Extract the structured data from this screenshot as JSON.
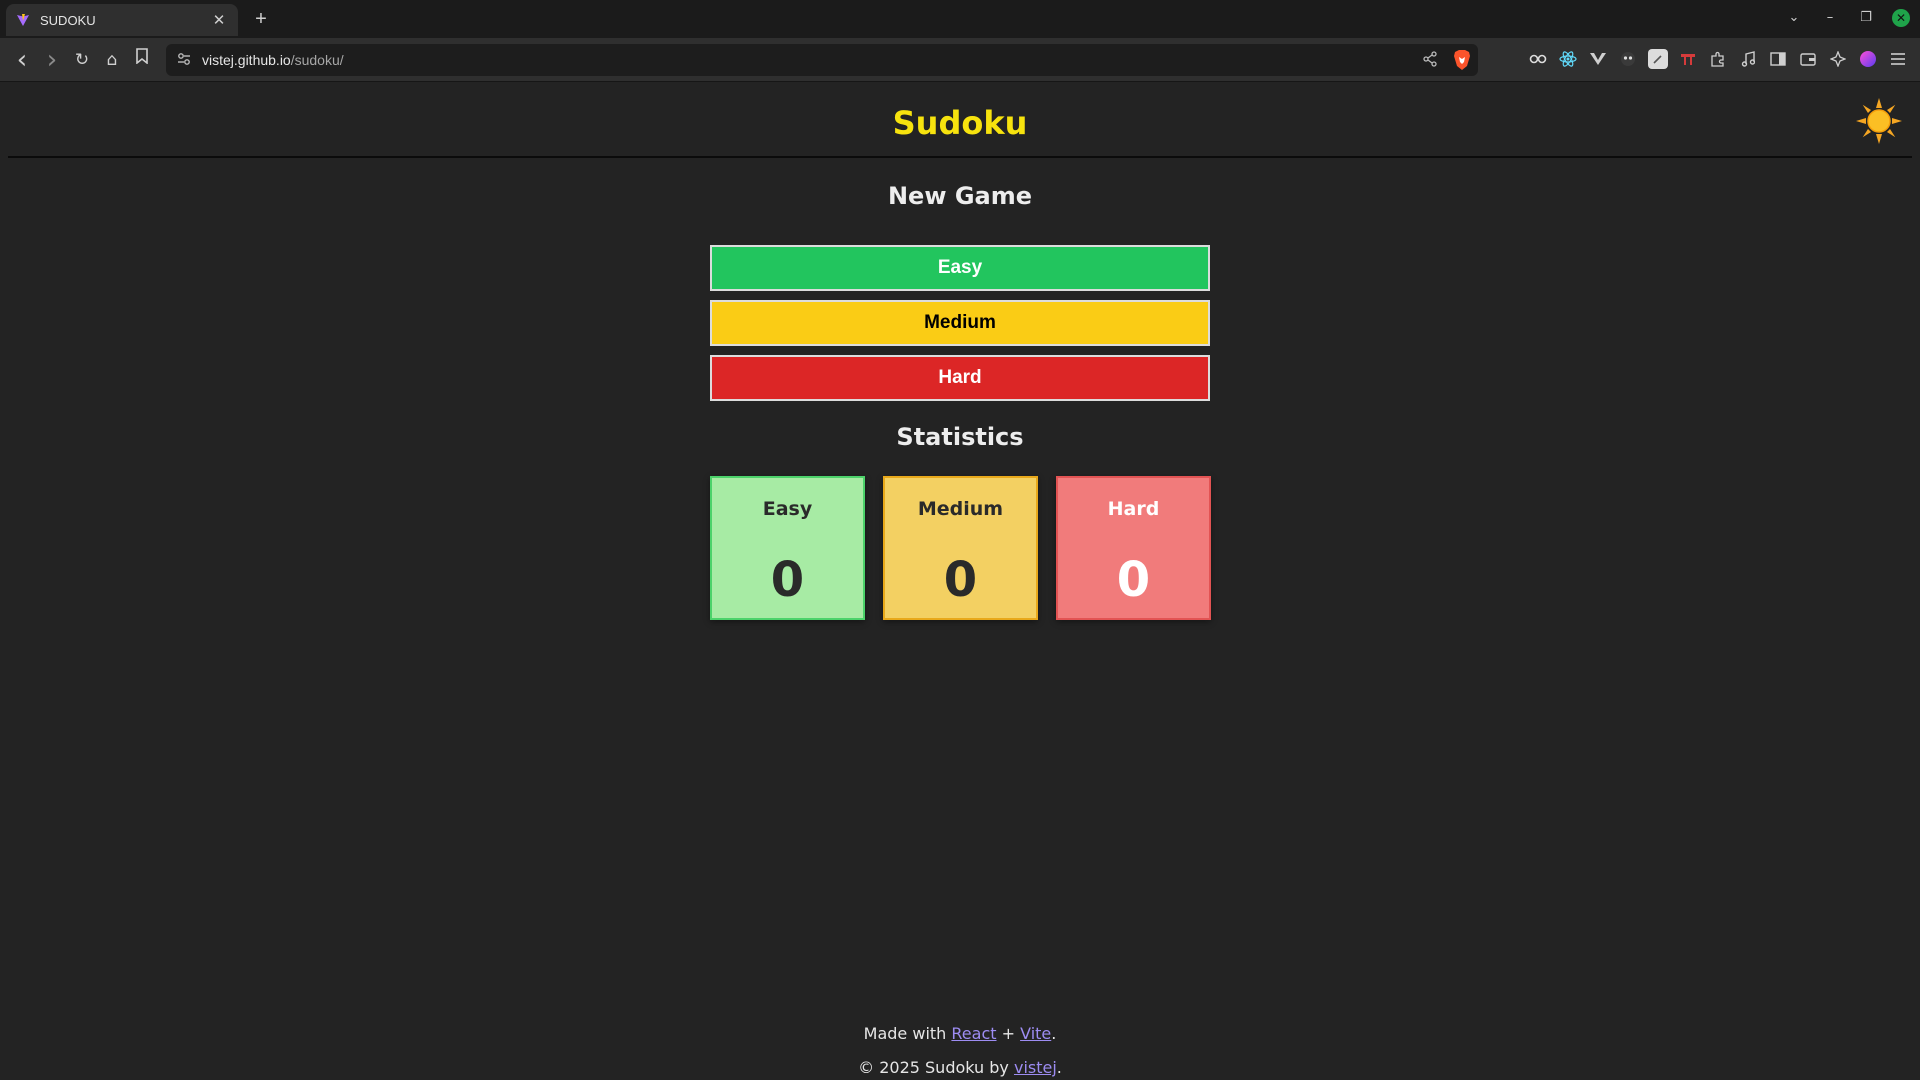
{
  "browser": {
    "tab": {
      "title": "SUDOKU",
      "close_glyph": "✕",
      "favicon": "vite-icon"
    },
    "new_tab_glyph": "+",
    "nav": {
      "back": "‹",
      "forward": "›",
      "reload": "↻",
      "home": "⌂",
      "bookmark": "🔖"
    },
    "url": {
      "host": "vistej.github.io",
      "path": "/sudoku/"
    },
    "window_controls": {
      "tab_list": "⌄",
      "minimize": "–",
      "maximize": "❐",
      "close": "✕"
    },
    "extensions": [
      "reader-icon",
      "react-devtools-icon",
      "vue-icon",
      "privacy-icon",
      "notes-icon",
      "translate-icon",
      "puzzle-icon",
      "music-icon",
      "sidebar-icon",
      "wallet-icon",
      "leo-ai-icon",
      "profile-icon",
      "menu-icon"
    ]
  },
  "app": {
    "title": "Sudoku",
    "theme_toggle_icon": "sun-icon",
    "new_game": {
      "heading": "New Game",
      "buttons": {
        "easy": "Easy",
        "medium": "Medium",
        "hard": "Hard"
      }
    },
    "statistics": {
      "heading": "Statistics",
      "cards": {
        "easy": {
          "label": "Easy",
          "value": "0"
        },
        "medium": {
          "label": "Medium",
          "value": "0"
        },
        "hard": {
          "label": "Hard",
          "value": "0"
        }
      }
    },
    "footer": {
      "made_with_prefix": "Made with ",
      "react_link": "React",
      "plus": " + ",
      "vite_link": "Vite",
      "period": ".",
      "copyright_prefix": "© 2025 Sudoku by ",
      "author_link": "vistej",
      "period2": "."
    }
  },
  "colors": {
    "background": "#232323",
    "title": "#f7e30e",
    "easy": "#22c55e",
    "medium": "#facc15",
    "hard": "#dc2626",
    "link": "#9d8cf2"
  }
}
